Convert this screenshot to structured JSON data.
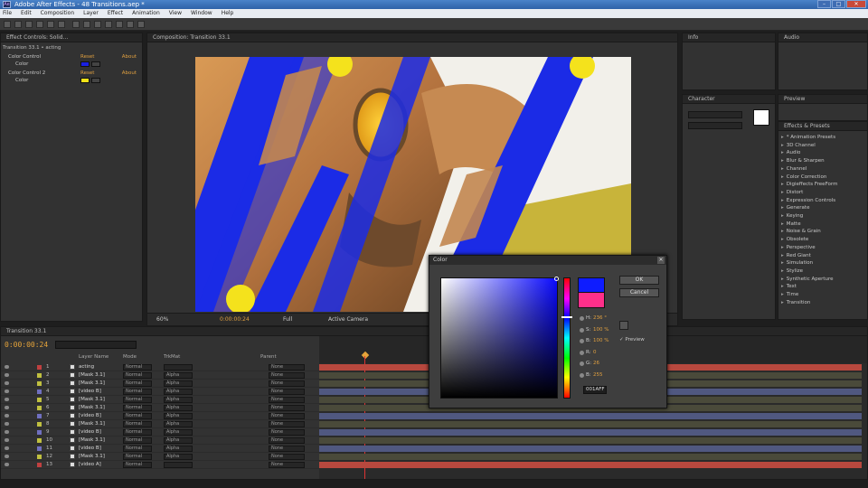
{
  "window": {
    "title": "Adobe After Effects - 48 Transitions.aep *",
    "minimize": "–",
    "maximize": "□",
    "close": "✕"
  },
  "menu": [
    "File",
    "Edit",
    "Composition",
    "Layer",
    "Effect",
    "Animation",
    "View",
    "Window",
    "Help"
  ],
  "effect_controls": {
    "tab": "Effect Controls: Solid...",
    "layer_label": "Transition 33.1 • acting",
    "rows": [
      {
        "name": "Color Control",
        "reset": "Reset",
        "about": "About",
        "sub": "Color",
        "swatch": "#1a20e0"
      },
      {
        "name": "Color Control 2",
        "reset": "Reset",
        "about": "About",
        "sub": "Color",
        "swatch": "#f2e218"
      }
    ]
  },
  "composition": {
    "tab": "Composition: Transition 33.1",
    "zoom": "60%",
    "timecode": "0:00:00:24",
    "resolution": "Full",
    "camera": "Active Camera"
  },
  "info_panel": {
    "tab": "Info"
  },
  "audio_panel": {
    "tab": "Audio"
  },
  "character_panel": {
    "tab": "Character"
  },
  "preview_panel": {
    "tab": "Preview"
  },
  "effects_presets": {
    "tab": "Effects & Presets",
    "items": [
      "* Animation Presets",
      "3D Channel",
      "Audio",
      "Blur & Sharpen",
      "Channel",
      "Color Correction",
      "Digieffects FreeForm",
      "Distort",
      "Expression Controls",
      "Generate",
      "Keying",
      "Matte",
      "Noise & Grain",
      "Obsolete",
      "Perspective",
      "Red Giant",
      "Simulation",
      "Stylize",
      "Synthetic Aperture",
      "Text",
      "Time",
      "Transition"
    ]
  },
  "timeline": {
    "time": "0:00:00:24",
    "headers": {
      "layer_name": "Layer Name",
      "mode": "Mode",
      "trkmat": "TrkMat",
      "parent": "Parent"
    },
    "layers": [
      {
        "num": "1",
        "name": "acting",
        "label": "#c04040",
        "mode": "Normal",
        "trk": "",
        "parent": "None"
      },
      {
        "num": "2",
        "name": "[Mask 3.1]",
        "label": "#c0c040",
        "mode": "Normal",
        "trk": "Alpha",
        "parent": "None"
      },
      {
        "num": "3",
        "name": "[Mask 3.1]",
        "label": "#c0c040",
        "mode": "Normal",
        "trk": "Alpha",
        "parent": "None"
      },
      {
        "num": "4",
        "name": "[video B]",
        "label": "#7070c0",
        "mode": "Normal",
        "trk": "Alpha",
        "parent": "None"
      },
      {
        "num": "5",
        "name": "[Mask 3.1]",
        "label": "#c0c040",
        "mode": "Normal",
        "trk": "Alpha",
        "parent": "None"
      },
      {
        "num": "6",
        "name": "[Mask 3.1]",
        "label": "#c0c040",
        "mode": "Normal",
        "trk": "Alpha",
        "parent": "None"
      },
      {
        "num": "7",
        "name": "[video B]",
        "label": "#7070c0",
        "mode": "Normal",
        "trk": "Alpha",
        "parent": "None"
      },
      {
        "num": "8",
        "name": "[Mask 3.1]",
        "label": "#c0c040",
        "mode": "Normal",
        "trk": "Alpha",
        "parent": "None"
      },
      {
        "num": "9",
        "name": "[video B]",
        "label": "#7070c0",
        "mode": "Normal",
        "trk": "Alpha",
        "parent": "None"
      },
      {
        "num": "10",
        "name": "[Mask 3.1]",
        "label": "#c0c040",
        "mode": "Normal",
        "trk": "Alpha",
        "parent": "None"
      },
      {
        "num": "11",
        "name": "[video B]",
        "label": "#7070c0",
        "mode": "Normal",
        "trk": "Alpha",
        "parent": "None"
      },
      {
        "num": "12",
        "name": "[Mask 3.1]",
        "label": "#c0c040",
        "mode": "Normal",
        "trk": "Alpha",
        "parent": "None"
      },
      {
        "num": "13",
        "name": "[video A]",
        "label": "#c04040",
        "mode": "Normal",
        "trk": "",
        "parent": "None"
      }
    ]
  },
  "color_picker": {
    "title": "Color",
    "ok": "OK",
    "cancel": "Cancel",
    "new_color": "#0e1cff",
    "current_color": "#ff2f8a",
    "fields": [
      {
        "label": "H:",
        "value": "236 °"
      },
      {
        "label": "S:",
        "value": "100 %"
      },
      {
        "label": "B:",
        "value": "100 %"
      },
      {
        "label": "R:",
        "value": "0"
      },
      {
        "label": "G:",
        "value": "26"
      },
      {
        "label": "B:",
        "value": "255"
      }
    ],
    "hex": "001AFF",
    "preview_label": "Preview"
  }
}
